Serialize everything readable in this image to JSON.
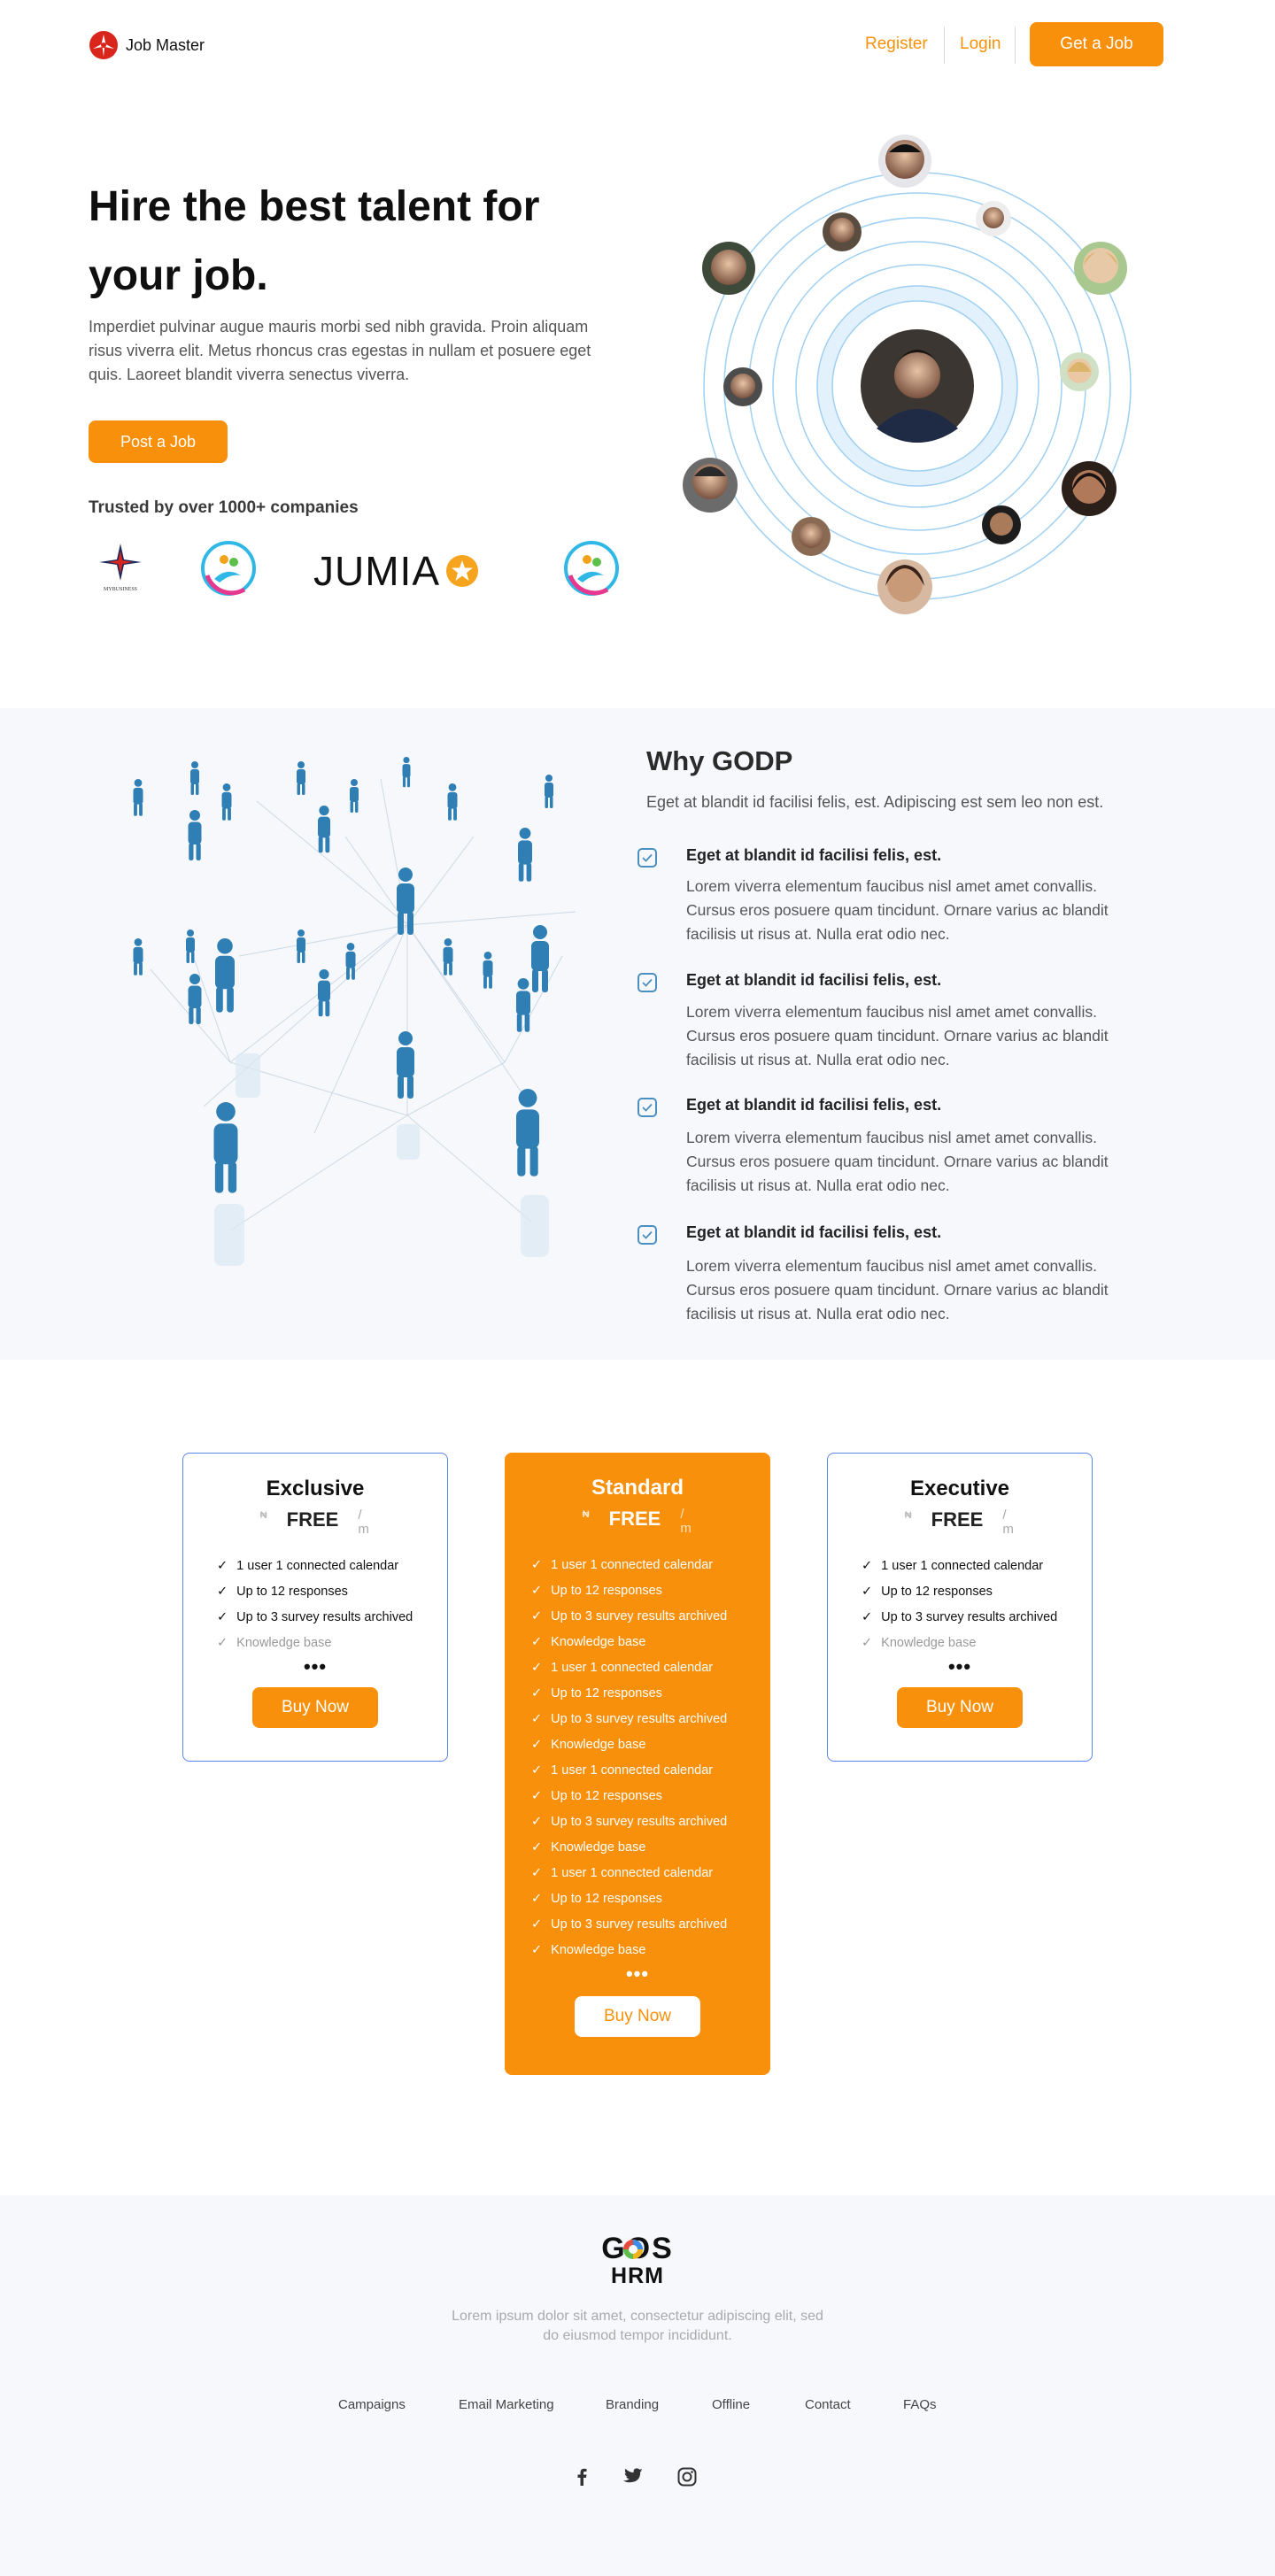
{
  "header": {
    "brand": "Job Master",
    "register_label": "Register",
    "login_label": "Login",
    "cta_label": "Get a Job"
  },
  "hero": {
    "title": "Hire the best talent for your job.",
    "description": "Imperdiet pulvinar augue mauris morbi sed nibh gravida. Proin aliquam risus viverra elit. Metus rhoncus cras egestas in nullam et posuere eget quis. Laoreet blandit viverra senectus viverra.",
    "post_label": "Post a Job",
    "trusted_text": "Trusted by over 1000+ companies",
    "logos": {
      "logo1_caption": "MYBUSINESS",
      "jumia": "JUMIA"
    }
  },
  "why": {
    "title": "Why GODP",
    "subtitle": "Eget at blandit id facilisi felis, est. Adipiscing est sem leo non est.",
    "features": [
      {
        "title": "Eget at blandit id facilisi felis, est.",
        "body": "Lorem viverra elementum faucibus nisl amet amet convallis. Cursus eros posuere quam tincidunt. Ornare varius ac blandit facilisis ut risus at. Nulla erat odio nec."
      },
      {
        "title": "Eget at blandit id facilisi felis, est.",
        "body": "Lorem viverra elementum faucibus nisl amet amet convallis. Cursus eros posuere quam tincidunt. Ornare varius ac blandit facilisis ut risus at. Nulla erat odio nec."
      },
      {
        "title": "Eget at blandit id facilisi felis, est.",
        "body": "Lorem viverra elementum faucibus nisl amet amet convallis. Cursus eros posuere quam tincidunt. Ornare varius ac blandit facilisis ut risus at. Nulla erat odio nec."
      },
      {
        "title": "Eget at blandit id facilisi felis, est.",
        "body": "Lorem viverra elementum faucibus nisl amet amet convallis. Cursus eros posuere quam tincidunt. Ornare varius ac blandit facilisis ut risus at. Nulla erat odio nec."
      }
    ]
  },
  "pricing": {
    "currency": "₦",
    "per": "/ m",
    "plans": [
      {
        "name": "Exclusive",
        "price": "FREE",
        "features": [
          "1 user 1 connected calendar",
          "Up to 12 responses",
          "Up to 3 survey results archived",
          "Knowledge base"
        ],
        "more": "•••",
        "button": "Buy Now"
      },
      {
        "name": "Standard",
        "price": "FREE",
        "features": [
          "1 user 1 connected calendar",
          "Up to 12 responses",
          "Up to 3 survey results archived",
          "Knowledge base",
          "1 user 1 connected calendar",
          "Up to 12 responses",
          "Up to 3 survey results archived",
          "Knowledge base",
          "1 user 1 connected calendar",
          "Up to 12 responses",
          "Up to 3 survey results archived",
          "Knowledge base",
          "1 user 1 connected calendar",
          "Up to 12 responses",
          "Up to 3 survey results archived",
          "Knowledge base"
        ],
        "more": "•••",
        "button": "Buy Now"
      },
      {
        "name": "Executive",
        "price": "FREE",
        "features": [
          "1 user 1 connected calendar",
          "Up to 12 responses",
          "Up to 3 survey results archived",
          "Knowledge base"
        ],
        "more": "•••",
        "button": "Buy Now"
      }
    ]
  },
  "footer": {
    "logo_top": "GOS",
    "logo_bottom": "HRM",
    "description": "Lorem ipsum dolor sit amet, consectetur adipiscing elit, sed do eiusmod tempor incididunt.",
    "links": [
      "Campaigns",
      "Email Marketing",
      "Branding",
      "Offline",
      "Contact",
      "FAQs"
    ],
    "socials": [
      "facebook-icon",
      "twitter-icon",
      "instagram-icon"
    ]
  },
  "colors": {
    "accent": "#f8900c",
    "card_border": "#5b87e8",
    "section_bg": "#f6f8fc",
    "orbit": "#8ec6ee"
  }
}
